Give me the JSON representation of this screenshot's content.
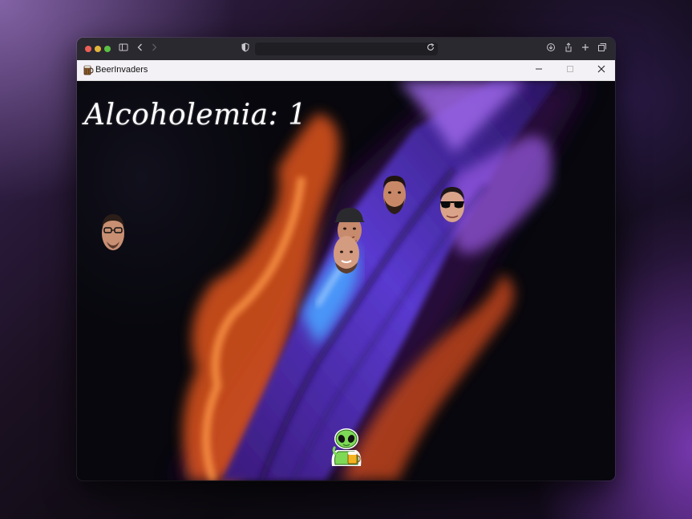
{
  "window": {
    "app_title": "BeerInvaders",
    "app_icon": "beer-mug-icon"
  },
  "browser_toolbar": {
    "icons": [
      "sidebar-icon",
      "back-icon",
      "forward-icon",
      "shield-icon",
      "reload-icon",
      "download-icon",
      "share-icon",
      "new-tab-icon",
      "tabs-overview-icon"
    ]
  },
  "game": {
    "score_text": "Alcoholemia: 1",
    "enemies": [
      {
        "name": "enemy-face-glasses-left"
      },
      {
        "name": "enemy-face-cap"
      },
      {
        "name": "enemy-face-bald"
      },
      {
        "name": "enemy-face-beard"
      },
      {
        "name": "enemy-face-sunglasses"
      }
    ],
    "player": "alien-with-beer"
  },
  "colors": {
    "nebula_orange": "#ff7a2e",
    "nebula_purple": "#7b3fe0",
    "nebula_blue": "#3a8cff",
    "alien_green": "#7ed957"
  }
}
